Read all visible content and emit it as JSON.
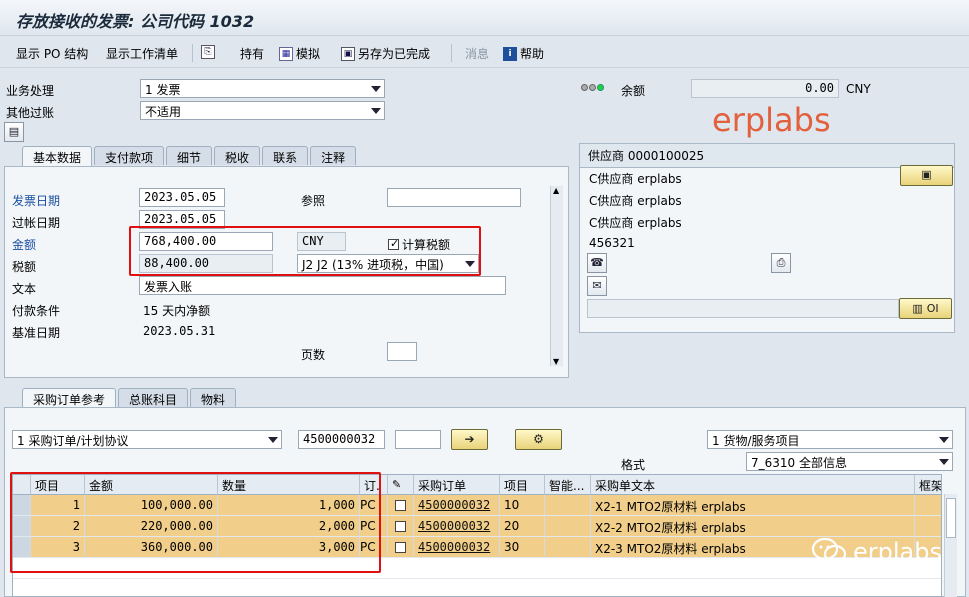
{
  "window": {
    "title": "存放接收的发票: 公司代码 1032"
  },
  "toolbar": {
    "show_po_structure": "显示 PO 结构",
    "show_worklist": "显示工作清单",
    "hold": "持有",
    "simulate": "模拟",
    "save_complete": "另存为已完成",
    "messages": "消息",
    "help": "帮助"
  },
  "header": {
    "transaction_label": "业务处理",
    "transaction_value": "1 发票",
    "other_posting_label": "其他过账",
    "other_posting_value": "不适用",
    "balance_label": "余额",
    "balance_value": "0.00",
    "balance_currency": "CNY"
  },
  "basic_tabs": [
    "基本数据",
    "支付款项",
    "细节",
    "税收",
    "联系",
    "注释"
  ],
  "basic": {
    "invoice_date_label": "发票日期",
    "invoice_date": "2023.05.05",
    "reference_label": "参照",
    "reference_value": "",
    "posting_date_label": "过帐日期",
    "posting_date": "2023.05.05",
    "amount_label": "金额",
    "amount": "768,400.00",
    "currency": "CNY",
    "calc_tax_label": "计算税额",
    "calc_tax_checked": true,
    "tax_label": "税额",
    "tax_amount": "88,400.00",
    "tax_code": "J2 J2 (13% 进项税，中国)",
    "text_label": "文本",
    "text_value": "发票入账",
    "payment_terms_label": "付款条件",
    "payment_terms_value": "15 天内净额",
    "baseline_date_label": "基准日期",
    "baseline_date": "2023.05.31",
    "pages_label": "页数",
    "pages_value": ""
  },
  "vendor": {
    "header": "供应商 0000100025",
    "line1": "C供应商 erplabs",
    "line2": "C供应商 erplabs",
    "line3": "C供应商 erplabs",
    "line4": "456321",
    "oi_label": "OI"
  },
  "ref_tabs": [
    "采购订单参考",
    "总账科目",
    "物料"
  ],
  "ref": {
    "ref_type": "1 采购订单/计划协议",
    "po_number": "4500000032",
    "item_value": "",
    "layout_select": "1 货物/服务项目",
    "format_label": "格式",
    "format_value": "7_6310 全部信息"
  },
  "grid": {
    "columns": [
      "项目",
      "金额",
      "数量",
      "订.",
      "",
      "采购订单",
      "项目",
      "智能...",
      "采购单文本",
      "框架"
    ],
    "rows": [
      {
        "item": "1",
        "amount": "100,000.00",
        "qty": "1,000",
        "unit": "PC",
        "po": "4500000032",
        "po_item": "10",
        "text": "X2-1 MTO2原材料 erplabs"
      },
      {
        "item": "2",
        "amount": "220,000.00",
        "qty": "2,000",
        "unit": "PC",
        "po": "4500000032",
        "po_item": "20",
        "text": "X2-2 MTO2原材料 erplabs"
      },
      {
        "item": "3",
        "amount": "360,000.00",
        "qty": "3,000",
        "unit": "PC",
        "po": "4500000032",
        "po_item": "30",
        "text": "X2-3 MTO2原材料 erplabs"
      }
    ]
  },
  "watermarks": {
    "top": "erplabs",
    "bottom": "erplabs"
  },
  "colors": {
    "highlight_row": "#f1ce8a",
    "annotation_red": "#e01010",
    "watermark": "#e2603c"
  }
}
